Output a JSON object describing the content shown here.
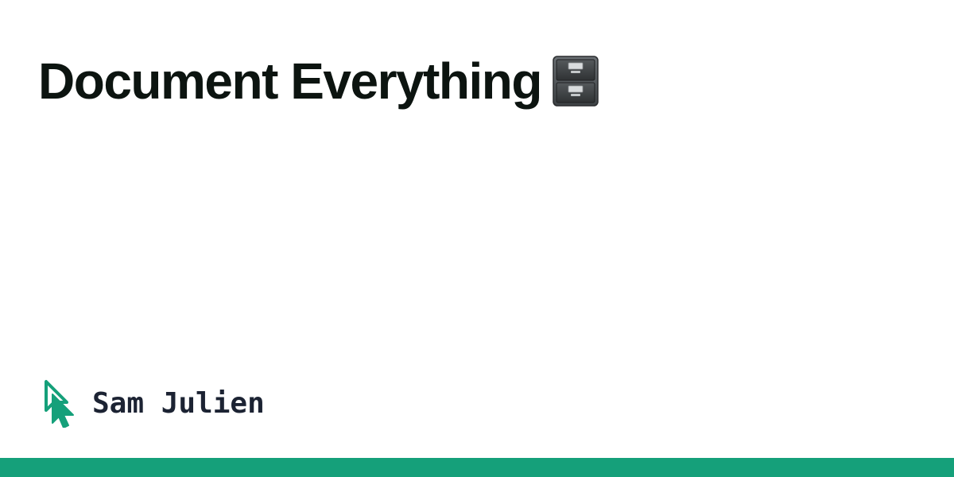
{
  "title": {
    "text": "Document Everything",
    "icon": "file-cabinet-icon"
  },
  "author": {
    "name": "Sam Julien",
    "logo_icon": "cursor-arrow-icon"
  },
  "colors": {
    "title_text": "#0c1410",
    "author_text": "#1c2333",
    "accent_green": "#15a07a",
    "background": "#ffffff"
  }
}
